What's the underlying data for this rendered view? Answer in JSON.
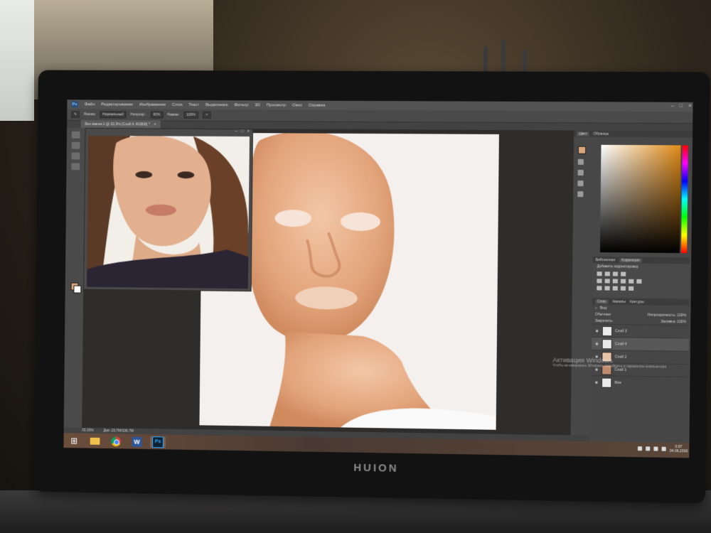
{
  "photoshop": {
    "logo": "Ps",
    "menu": [
      "Файл",
      "Редактирование",
      "Изображение",
      "Слои",
      "Текст",
      "Выделение",
      "Фильтр",
      "3D",
      "Просмотр",
      "Окно",
      "Справка"
    ],
    "options": {
      "mode_label": "Режим:",
      "mode_value": "Нормальный",
      "opacity_label": "Непрозр.:",
      "opacity_value": "60%",
      "flow_label": "Нажим:",
      "flow_value": "100%"
    },
    "document_tab": "Без имени-1 @ 33,3% (Слой 4, RGB/8) *",
    "document_tab_close": "×",
    "window_controls": [
      "–",
      "□",
      "×"
    ],
    "ref_window_controls": [
      "–",
      "□",
      "×"
    ]
  },
  "panels": {
    "color_tabs": [
      "Цвет",
      "Образцы"
    ],
    "adjustments_tabs": [
      "Библиотеки",
      "Коррекция"
    ],
    "adjustments_title": "Добавить корректировку",
    "layers_tabs": [
      "Слои",
      "Каналы",
      "Контуры"
    ],
    "layers_filter": "Вид",
    "blend_mode": "Обычные",
    "opacity_label": "Непрозрачность:",
    "opacity_value": "100%",
    "lock_label": "Закрепить:",
    "fill_label": "Заливка:",
    "fill_value": "100%",
    "layers": [
      {
        "name": "Слой 3",
        "thumb": "plain",
        "selected": false
      },
      {
        "name": "Слой 4",
        "thumb": "plain",
        "selected": true
      },
      {
        "name": "Слой 2",
        "thumb": "skin",
        "selected": false
      },
      {
        "name": "Слой 1",
        "thumb": "face",
        "selected": false
      },
      {
        "name": "Фон",
        "thumb": "plain",
        "selected": false
      }
    ]
  },
  "status": {
    "zoom": "33,33%",
    "doc": "Док: 23,7M/106,7M"
  },
  "activation": {
    "title": "Активация Windows",
    "subtitle": "Чтобы активировать Windows, перейдите в параметры компьютера."
  },
  "taskbar": {
    "start": "⊞",
    "word": "W",
    "ps": "Ps",
    "clock_time": "0:07",
    "clock_date": "04.06.2016"
  },
  "monitor": {
    "brand": "HUION"
  },
  "colors": {
    "foreground": "#d9a57a",
    "background": "#ffffff",
    "skin_paint": "#e7ab80",
    "hue_marker": "#e08a17"
  }
}
